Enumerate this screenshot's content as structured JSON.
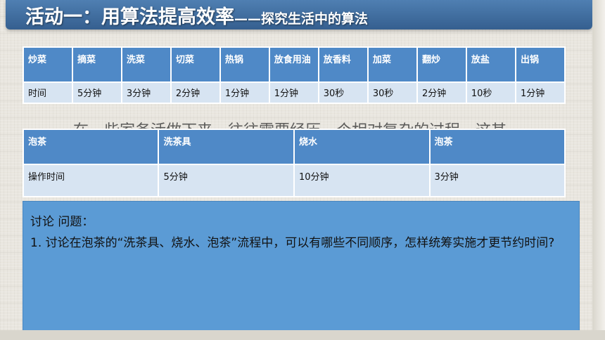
{
  "title": {
    "main": "活动一：用算法提高效率",
    "sub": "——探究生活中的算法"
  },
  "table1": {
    "headers": [
      "炒菜",
      "摘菜",
      "洗菜",
      "切菜",
      "热锅",
      "放食用油",
      "放香料",
      "加菜",
      "翻炒",
      "放盐",
      "出锅"
    ],
    "values": [
      "时间",
      "5分钟",
      "3分钟",
      "2分钟",
      "1分钟",
      "1分钟",
      "30秒",
      "30秒",
      "2分钟",
      "10秒",
      "1分钟"
    ]
  },
  "ghost_text": "在一些家务活做下来，往往需要经历一个相对复杂的过程，这其",
  "table2": {
    "headers": [
      "泡茶",
      "洗茶具",
      "烧水",
      "泡茶"
    ],
    "values": [
      "操作时间",
      "5分钟",
      "10分钟",
      "3分钟"
    ]
  },
  "discussion": {
    "title": "讨论 问题：",
    "question": "1. 讨论在泡茶的“洗茶具、烧水、泡茶”流程中，可以有哪些不同顺序，怎样统筹实施才更节约时间?"
  }
}
